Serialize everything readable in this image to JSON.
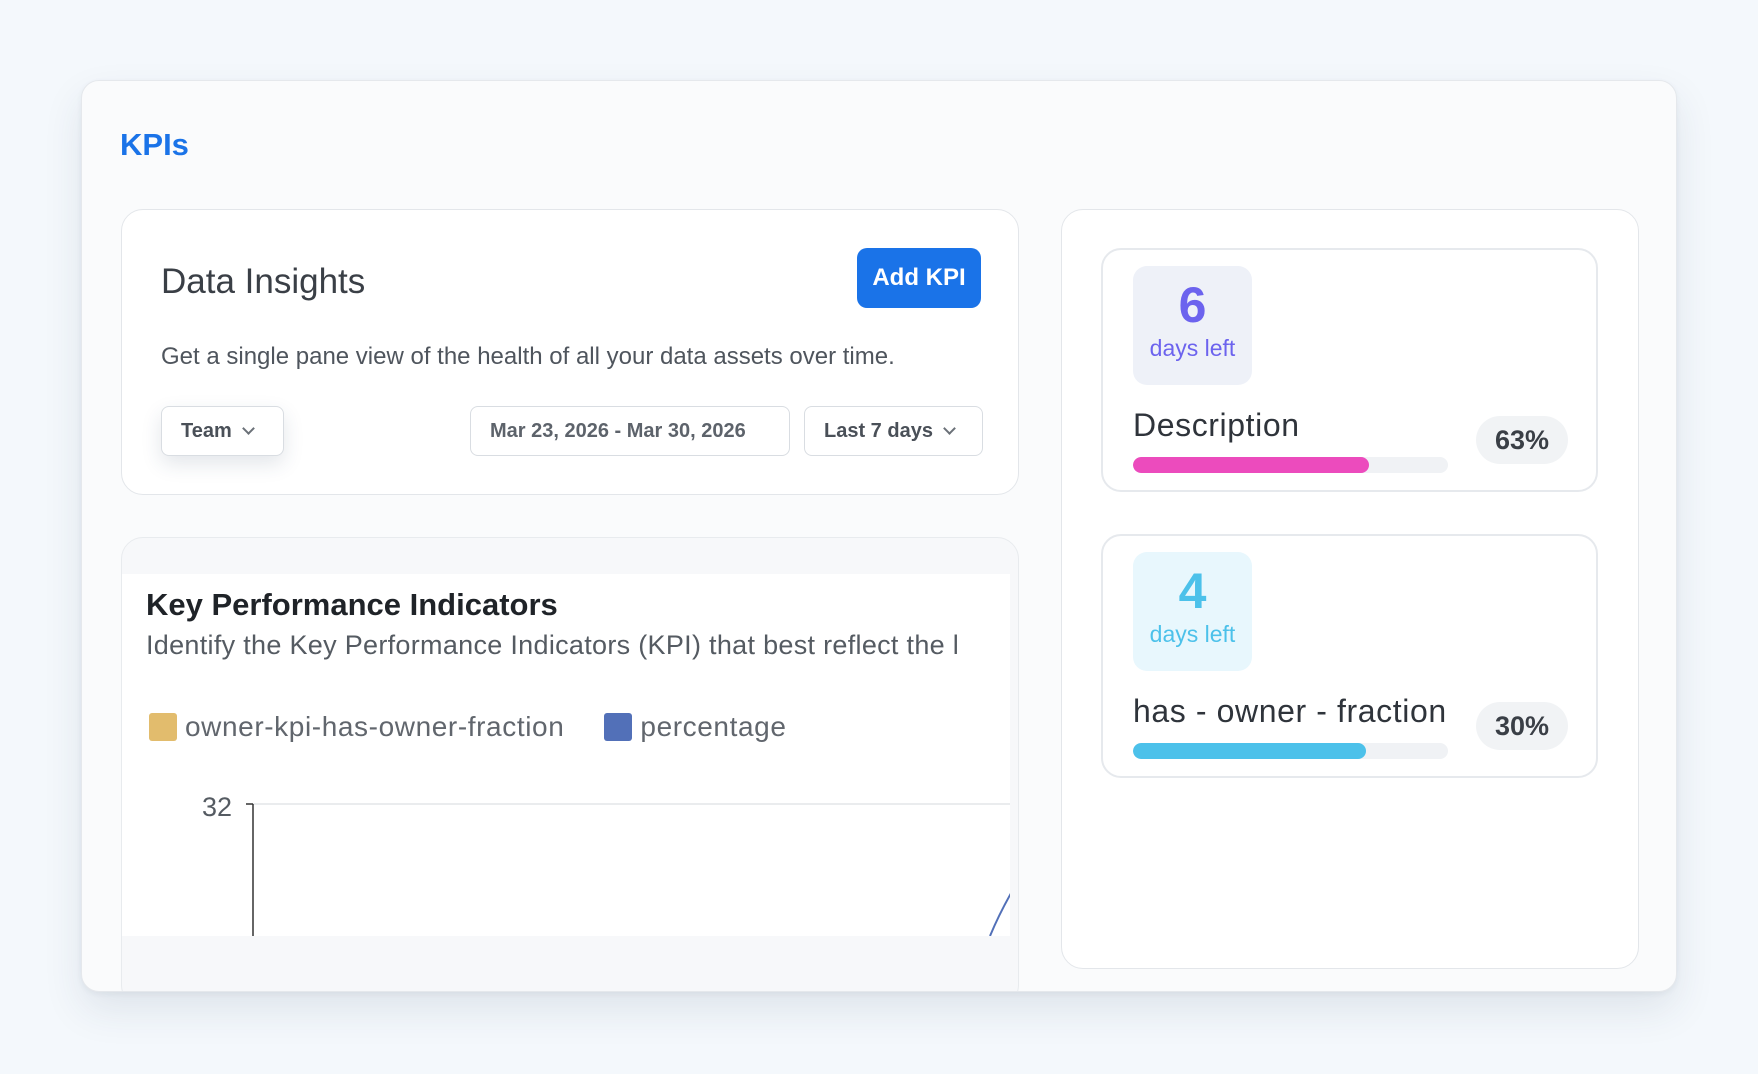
{
  "page": {
    "title": "KPIs"
  },
  "insights": {
    "title": "Data Insights",
    "add_button": "Add KPI",
    "subtitle": "Get a single pane view of the health of all your data assets over time.",
    "team_filter": "Team",
    "date_range": "Mar 23, 2026 - Mar 30, 2026",
    "period_filter": "Last 7 days"
  },
  "kpi_chart": {
    "title": "Key Performance Indicators",
    "subtitle": "Identify the Key Performance Indicators (KPI) that best reflect the l",
    "legend": [
      {
        "label": "owner-kpi-has-owner-fraction",
        "color": "#e2bc6d"
      },
      {
        "label": "percentage",
        "color": "#5270b8"
      }
    ],
    "y_tick": "32"
  },
  "kpi_cards": [
    {
      "days": "6",
      "days_label": "days left",
      "name": "Description",
      "percent": "63%",
      "progress": 0.75,
      "color": "#ec4bbd"
    },
    {
      "days": "4",
      "days_label": "days left",
      "name": "has - owner - fraction",
      "percent": "30%",
      "progress": 0.74,
      "color": "#4cc1ea"
    }
  ],
  "chart_data": {
    "type": "line",
    "title": "Key Performance Indicators",
    "series": [
      {
        "name": "owner-kpi-has-owner-fraction",
        "values": []
      },
      {
        "name": "percentage",
        "values": []
      }
    ],
    "y_ticks": [
      "32"
    ]
  }
}
